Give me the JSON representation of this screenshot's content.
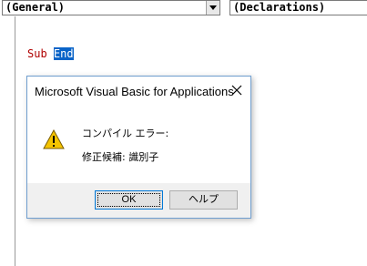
{
  "toolbar": {
    "object_combo": "(General)",
    "procedure_combo": "(Declarations)"
  },
  "editor": {
    "keyword_sub": "Sub",
    "keyword_end": "End"
  },
  "dialog": {
    "title": "Microsoft Visual Basic for Applications",
    "message_line1": "コンパイル エラー:",
    "message_line2": "修正候補: 識別子",
    "ok_label": "OK",
    "help_label": "ヘルプ",
    "icon": "warning-icon"
  },
  "colors": {
    "keyword": "#b00000",
    "selection": "#0a64c8",
    "ok_border": "#0078d7",
    "dialog_border": "#6f9ecf"
  }
}
